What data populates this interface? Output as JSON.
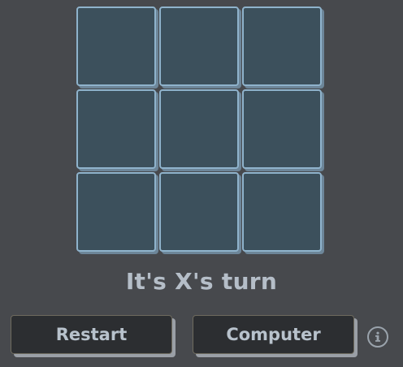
{
  "board": {
    "cells": [
      "",
      "",
      "",
      "",
      "",
      "",
      "",
      "",
      ""
    ]
  },
  "status": {
    "text": "It's X's turn"
  },
  "controls": {
    "restart_label": "Restart",
    "computer_label": "Computer"
  },
  "icons": {
    "info": "info-icon"
  },
  "colors": {
    "background": "#47494d",
    "cell_fill": "#3c505c",
    "cell_border": "#8fb3cc",
    "button_fill": "#2c2e31",
    "text": "#b5bec8"
  }
}
